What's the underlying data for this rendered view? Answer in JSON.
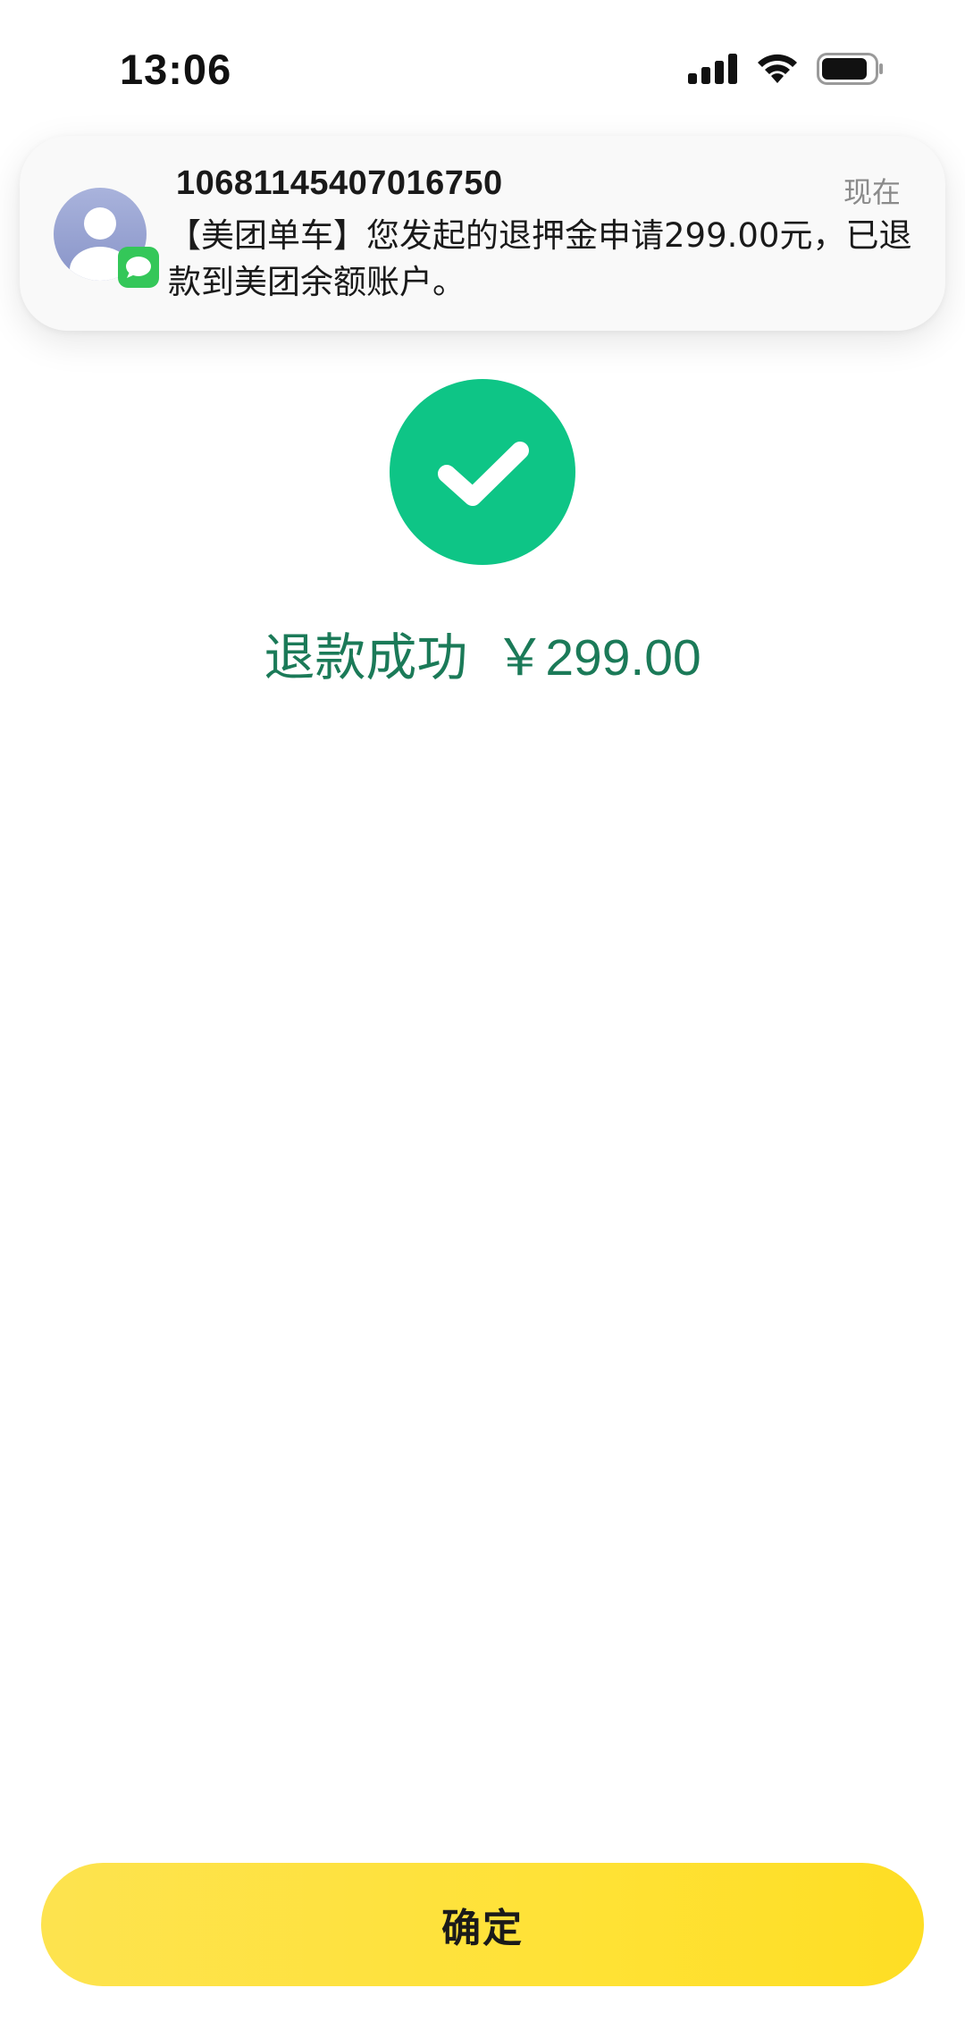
{
  "status_bar": {
    "time": "13:06",
    "icons": [
      "cellular-signal-icon",
      "wifi-icon",
      "battery-icon"
    ]
  },
  "notification": {
    "sender": "10681145407016750",
    "time": "现在",
    "body": "【美团单车】您发起的退押金申请299.00元，已退款到美团余额账户。",
    "icons": [
      "contact-avatar-icon",
      "messages-app-icon"
    ]
  },
  "result": {
    "icon": "checkmark-icon",
    "status_text": "退款成功",
    "amount": "￥299.00"
  },
  "actions": {
    "confirm_label": "确定"
  },
  "colors": {
    "success_green": "#0ec586",
    "success_text": "#1b7a58",
    "button_yellow": "#ffe236",
    "messages_green": "#34c759"
  }
}
